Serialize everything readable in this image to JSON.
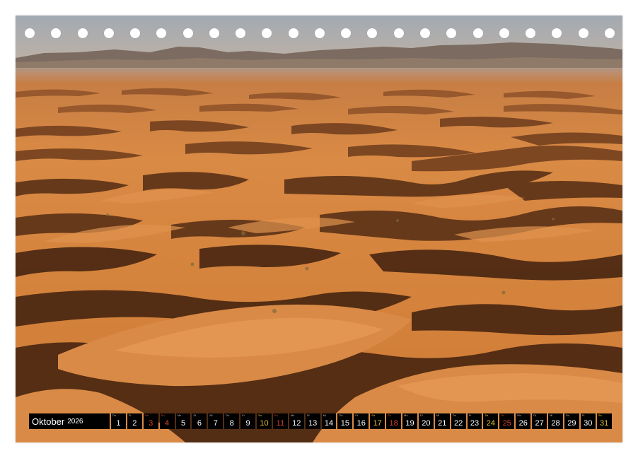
{
  "calendar": {
    "month": "Oktober",
    "year": "2026",
    "days": [
      {
        "dow": "Do",
        "num": "1",
        "type": "weekday"
      },
      {
        "dow": "Fr",
        "num": "2",
        "type": "weekday"
      },
      {
        "dow": "Sa",
        "num": "3",
        "type": "sun"
      },
      {
        "dow": "So",
        "num": "4",
        "type": "sun"
      },
      {
        "dow": "Mo",
        "num": "5",
        "type": "weekday"
      },
      {
        "dow": "Di",
        "num": "6",
        "type": "weekday"
      },
      {
        "dow": "Mi",
        "num": "7",
        "type": "weekday"
      },
      {
        "dow": "Do",
        "num": "8",
        "type": "weekday"
      },
      {
        "dow": "Fr",
        "num": "9",
        "type": "weekday"
      },
      {
        "dow": "Sa",
        "num": "10",
        "type": "sat"
      },
      {
        "dow": "So",
        "num": "11",
        "type": "sun"
      },
      {
        "dow": "Mo",
        "num": "12",
        "type": "weekday"
      },
      {
        "dow": "Di",
        "num": "13",
        "type": "weekday"
      },
      {
        "dow": "Mi",
        "num": "14",
        "type": "weekday"
      },
      {
        "dow": "Do",
        "num": "15",
        "type": "weekday"
      },
      {
        "dow": "Fr",
        "num": "16",
        "type": "weekday"
      },
      {
        "dow": "Sa",
        "num": "17",
        "type": "sat"
      },
      {
        "dow": "So",
        "num": "18",
        "type": "sun"
      },
      {
        "dow": "Mo",
        "num": "19",
        "type": "weekday"
      },
      {
        "dow": "Di",
        "num": "20",
        "type": "weekday"
      },
      {
        "dow": "Mi",
        "num": "21",
        "type": "weekday"
      },
      {
        "dow": "Do",
        "num": "22",
        "type": "weekday"
      },
      {
        "dow": "Fr",
        "num": "23",
        "type": "weekday"
      },
      {
        "dow": "Sa",
        "num": "24",
        "type": "sat"
      },
      {
        "dow": "So",
        "num": "25",
        "type": "sun"
      },
      {
        "dow": "Mo",
        "num": "26",
        "type": "weekday"
      },
      {
        "dow": "Di",
        "num": "27",
        "type": "weekday"
      },
      {
        "dow": "Mi",
        "num": "28",
        "type": "weekday"
      },
      {
        "dow": "Do",
        "num": "29",
        "type": "weekday"
      },
      {
        "dow": "Fr",
        "num": "30",
        "type": "weekday"
      },
      {
        "dow": "Sa",
        "num": "31",
        "type": "sat"
      }
    ]
  },
  "binding_hole_count": 23,
  "colors": {
    "sky": "#a9b0b6",
    "mountains": "#7e6f63",
    "dune_light": "#dd8a3e",
    "dune_shadow": "#5e3518",
    "saturday": "#e8c332",
    "sunday": "#e0462e"
  }
}
